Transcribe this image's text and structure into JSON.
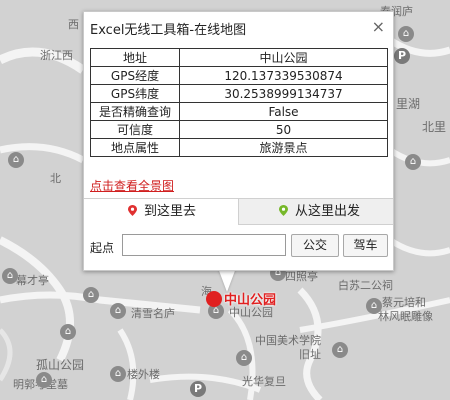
{
  "popup": {
    "title": "Excel无线工具箱-在线地图",
    "close_glyph": "×",
    "table": [
      {
        "key": "地址",
        "value": "中山公园"
      },
      {
        "key": "GPS经度",
        "value": "120.137339530874"
      },
      {
        "key": "GPS纬度",
        "value": "30.2538999134737"
      },
      {
        "key": "是否精确查询",
        "value": "False"
      },
      {
        "key": "可信度",
        "value": "50"
      },
      {
        "key": "地点属性",
        "value": "旅游景点"
      }
    ],
    "panorama_link": "点击查看全景图",
    "tabs": [
      {
        "label": "到这里去",
        "icon": "red-pin-icon",
        "color": "#e03030"
      },
      {
        "label": "从这里出发",
        "icon": "green-pin-icon",
        "color": "#77b82a"
      }
    ],
    "origin_label": "起点",
    "origin_value": "",
    "bus_button": "公交",
    "drive_button": "驾车"
  },
  "map": {
    "marker_label": "中山公园",
    "marker_color": "#e02020",
    "parking_glyph": "P",
    "labels": [
      "西",
      "浙江西",
      "春润庐",
      "里湖",
      "北里",
      "北",
      "幕才亭",
      "海",
      "四照亭",
      "白苏二公祠",
      "蔡元培和",
      "林风眠雕像",
      "清雪名庐",
      "中山公园",
      "孤山公园",
      "中国美术学院",
      "旧址",
      "楼外楼",
      "明郭考堂墓",
      "光华复旦"
    ]
  }
}
